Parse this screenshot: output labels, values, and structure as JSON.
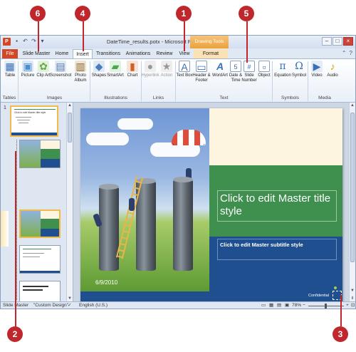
{
  "window": {
    "title": "DateTime_results.potx - Microsoft PowerPoint",
    "app_icon_letter": "P",
    "context_tool_label": "Drawing Tools"
  },
  "quick_access": [
    "save-icon",
    "undo-icon",
    "redo-icon",
    "customize-icon"
  ],
  "tabs": [
    {
      "label": "File"
    },
    {
      "label": "Slide Master"
    },
    {
      "label": "Home"
    },
    {
      "label": "Insert"
    },
    {
      "label": "Transitions"
    },
    {
      "label": "Animations"
    },
    {
      "label": "Review"
    },
    {
      "label": "View"
    },
    {
      "label": "Format"
    }
  ],
  "ribbon": {
    "buttons": [
      {
        "label": "Table",
        "icon": "table-icon",
        "color": "#3b6fb6"
      },
      {
        "label": "Picture",
        "icon": "picture-icon",
        "color": "#4c8dcf"
      },
      {
        "label": "Clip Art",
        "icon": "clipart-icon",
        "color": "#6aa84f"
      },
      {
        "label": "Screenshot",
        "icon": "screenshot-icon",
        "color": "#5b7fb0"
      },
      {
        "label": "Photo Album",
        "icon": "photo-album-icon",
        "color": "#8a6d3b"
      },
      {
        "label": "Shapes",
        "icon": "shapes-icon",
        "color": "#4a7ebb"
      },
      {
        "label": "SmartArt",
        "icon": "smartart-icon",
        "color": "#4ca64c"
      },
      {
        "label": "Chart",
        "icon": "chart-icon",
        "color": "#d35f2a"
      },
      {
        "label": "Hyperlink",
        "icon": "hyperlink-icon",
        "color": "#999999"
      },
      {
        "label": "Action",
        "icon": "action-icon",
        "color": "#999999"
      },
      {
        "label": "Text Box",
        "icon": "textbox-icon",
        "color": "#3b6fb6"
      },
      {
        "label": "Header & Footer",
        "icon": "header-footer-icon",
        "color": "#3b6fb6"
      },
      {
        "label": "WordArt",
        "icon": "wordart-icon",
        "color": "#3b6fb6"
      },
      {
        "label": "Date & Time",
        "icon": "date-time-icon",
        "color": "#3b6fb6"
      },
      {
        "label": "Slide Number",
        "icon": "slide-number-icon",
        "color": "#3b6fb6"
      },
      {
        "label": "Object",
        "icon": "object-icon",
        "color": "#3b6fb6"
      },
      {
        "label": "Equation",
        "icon": "equation-icon",
        "color": "#3b6fb6"
      },
      {
        "label": "Symbol",
        "icon": "symbol-icon",
        "color": "#3b6fb6"
      },
      {
        "label": "Video",
        "icon": "video-icon",
        "color": "#3b6fb6"
      },
      {
        "label": "Audio",
        "icon": "audio-icon",
        "color": "#3b6fb6"
      }
    ],
    "groups": [
      "Tables",
      "Images",
      "Illustrations",
      "Links",
      "Text",
      "Symbols",
      "Media"
    ]
  },
  "slide": {
    "title_placeholder": "Click to edit Master title style",
    "subtitle_placeholder": "Click to edit Master subtitle style",
    "date": "6/9/2010",
    "footer": "Confidential"
  },
  "thumbnails": {
    "master_number": "1",
    "master_title": "Click to edit Master title style",
    "master_body": "Click to edit Master text styles",
    "layout_count": 6
  },
  "statusbar": {
    "view": "Slide Master",
    "theme": "\"Custom Design\"",
    "language": "English (U.S.)",
    "zoom": "78%"
  },
  "callouts": [
    "6",
    "4",
    "1",
    "5",
    "2",
    "3"
  ],
  "colors": {
    "accent_red": "#c0272d",
    "file_tab": "#d24726",
    "slide_green": "#3f8f4e",
    "slide_blue": "#1f4f8f"
  }
}
